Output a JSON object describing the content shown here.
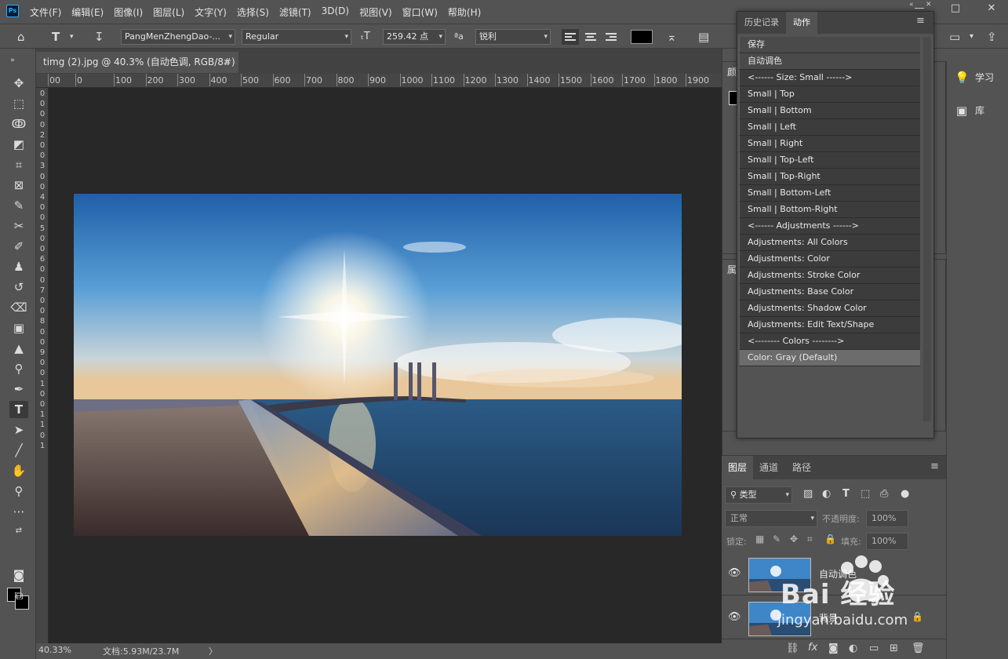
{
  "app": {
    "logo": "Ps"
  },
  "menu": [
    "文件(F)",
    "编辑(E)",
    "图像(I)",
    "图层(L)",
    "文字(Y)",
    "选择(S)",
    "滤镜(T)",
    "3D(D)",
    "视图(V)",
    "窗口(W)",
    "帮助(H)"
  ],
  "window_controls": {
    "minimize": "—",
    "maximize": "□",
    "close": "✕"
  },
  "options": {
    "font_family": "PangMenZhengDao-...",
    "font_style": "Regular",
    "font_size": "259.42 点",
    "aa_label": "ªa",
    "aa_value": "锐利",
    "text_color": "#000000"
  },
  "document": {
    "tab_title": "timg (2).jpg @ 40.3% (自动色调, RGB/8#) *",
    "close": "×"
  },
  "ruler": {
    "top": [
      "00",
      "0",
      "100",
      "200",
      "300",
      "400",
      "500",
      "600",
      "700",
      "800",
      "900",
      "1000",
      "1100",
      "1200",
      "1300",
      "1400",
      "1500",
      "1600",
      "1700",
      "1800",
      "1900"
    ],
    "left": [
      "0",
      "0",
      "0",
      "0",
      "2",
      "0",
      "0",
      "3",
      "0",
      "0",
      "4",
      "0",
      "0",
      "5",
      "0",
      "0",
      "6",
      "0",
      "0",
      "7",
      "0",
      "0",
      "8",
      "0",
      "0",
      "9",
      "0",
      "0",
      "1",
      "0",
      "0",
      "1",
      "1",
      "0",
      "1"
    ]
  },
  "status": {
    "zoom": "40.33%",
    "doc_size": "文档:5.93M/23.7M",
    "arrow": "〉"
  },
  "side_panel": [
    {
      "icon": "lightbulb-icon",
      "glyph": "💡",
      "label": "学习"
    },
    {
      "icon": "library-icon",
      "glyph": "▣",
      "label": "库"
    }
  ],
  "panels": {
    "color_label": "颜",
    "props_label": "属"
  },
  "actions_panel": {
    "tabs": [
      "历史记录",
      "动作"
    ],
    "active_tab": "动作",
    "items": [
      "保存",
      "自动调色",
      "<------ Size: Small ------>",
      "Small | Top",
      "Small | Bottom",
      "Small | Left",
      "Small | Right",
      "Small | Top-Left",
      "Small | Top-Right",
      "Small | Bottom-Left",
      "Small | Bottom-Right",
      "<------ Adjustments ------>",
      "Adjustments: All Colors",
      "Adjustments: Color",
      "Adjustments: Stroke Color",
      "Adjustments: Base Color",
      "Adjustments: Shadow Color",
      "Adjustments: Edit Text/Shape",
      "<-------- Colors -------->",
      "Color: Gray (Default)"
    ]
  },
  "layers_panel": {
    "tabs": [
      "图层",
      "通道",
      "路径"
    ],
    "filter_label": "类型",
    "blend_mode": "正常",
    "opacity_label": "不透明度:",
    "opacity_value": "100%",
    "lock_label": "锁定:",
    "fill_label": "填充:",
    "fill_value": "100%",
    "layers": [
      {
        "name": "自动调色"
      },
      {
        "name": "背景"
      }
    ]
  },
  "watermark": {
    "text": "Bai 经验",
    "url": "jingyan.baidu.com"
  }
}
